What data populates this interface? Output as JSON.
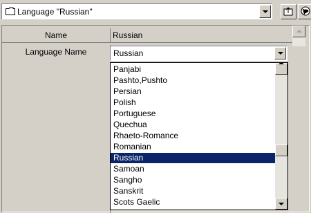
{
  "top_combo": {
    "value": "Language \"Russian\""
  },
  "grid": {
    "rows": [
      {
        "name": "Name",
        "value": "Russian"
      },
      {
        "name": "Language Name",
        "value": "Russian"
      }
    ]
  },
  "language_select": {
    "selected": "Russian",
    "options": [
      "Panjabi",
      "Pashto,Pushto",
      "Persian",
      "Polish",
      "Portuguese",
      "Quechua",
      "Rhaeto-Romance",
      "Romanian",
      "Russian",
      "Samoan",
      "Sangho",
      "Sanskrit",
      "Scots Gaelic"
    ]
  },
  "colors": {
    "selection": "#0a246a",
    "face": "#d4d0c8"
  }
}
